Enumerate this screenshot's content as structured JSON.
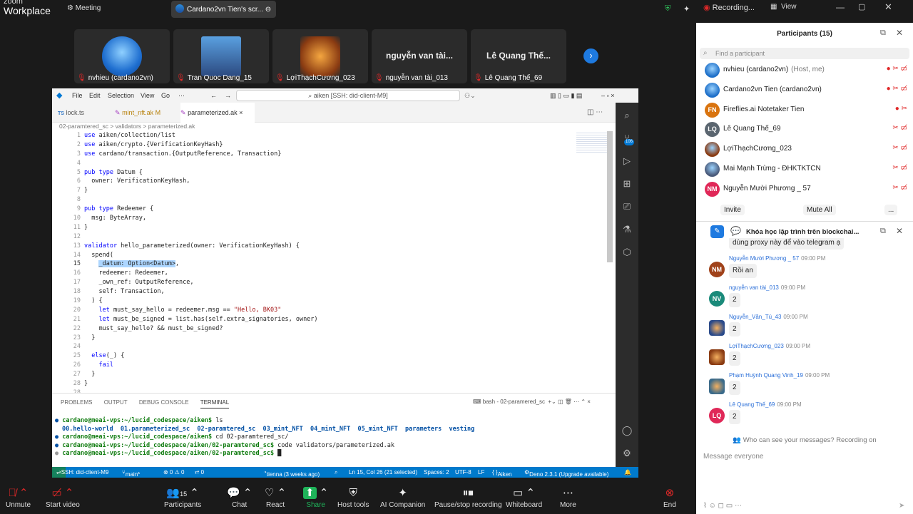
{
  "app": {
    "brand_top": "zoom",
    "brand": "Workplace",
    "meeting_label": "Meeting",
    "share_tab": "Cardano2vn Tien's scr...",
    "recording": "Recording...",
    "view": "View"
  },
  "thumbs": [
    {
      "name": "nvhieu (cardano2vn)"
    },
    {
      "name": "Tran Quoc Dang_15"
    },
    {
      "name": "LợiThạchCương_023"
    },
    {
      "name": "nguyễn van tài_013",
      "big": "nguyễn van tài..."
    },
    {
      "name": "Lê Quang Thế_69",
      "big": "Lê Quang Thế..."
    }
  ],
  "vscode": {
    "menu": [
      "File",
      "Edit",
      "Selection",
      "View",
      "Go",
      "⋯"
    ],
    "search": "aiken [SSH: did-client-M9]",
    "tabs": [
      {
        "label": "lock.ts"
      },
      {
        "label": "mint_nft.ak M"
      },
      {
        "label": "parameterized.ak"
      }
    ],
    "breadcrumb": "02-paramtered_sc  >  validators  >  parameterized.ak",
    "code": [
      "use aiken/collection/list",
      "use aiken/crypto.{VerificationKeyHash}",
      "use cardano/transaction.{OutputReference, Transaction}",
      "",
      "pub type Datum {",
      "  owner: VerificationKeyHash,",
      "}",
      "",
      "pub type Redeemer {",
      "  msg: ByteArray,",
      "}",
      "",
      "validator hello_parameterized(owner: VerificationKeyHash) {",
      "  spend(",
      "    _datum: Option<Datum>,",
      "    redeemer: Redeemer,",
      "    _own_ref: OutputReference,",
      "    self: Transaction,",
      "  ) {",
      "    let must_say_hello = redeemer.msg == \"Hello, BK03\"",
      "    let must_be_signed = list.has(self.extra_signatories, owner)",
      "    must_say_hello? && must_be_signed?",
      "  }",
      "",
      "  else(_) {",
      "    fail",
      "  }",
      "}"
    ],
    "panel_tabs": [
      "PROBLEMS",
      "OUTPUT",
      "DEBUG CONSOLE",
      "TERMINAL"
    ],
    "terminal_label": "bash - 02-paramered_sc",
    "terminal": [
      {
        "prompt": "cardano@meai-vps:~/lucid_codespace/aiken$",
        "cmd": " ls"
      },
      {
        "out": "00.hello-world  01.parameterized_sc  02-paramtered_sc  03_mint_NFT  04_mint_NFT  05_mint_NFT  parameters  vesting"
      },
      {
        "prompt": "cardano@meai-vps:~/lucid_codespace/aiken$",
        "cmd": " cd 02-paramtered_sc/"
      },
      {
        "prompt": "cardano@meai-vps:~/lucid_codespace/aiken/02-paramtered_sc$",
        "cmd": " code validators/parameterized.ak"
      },
      {
        "prompt": "cardano@meai-vps:~/lucid_codespace/aiken/02-paramtered_sc$",
        "cmd": " █"
      }
    ],
    "status": {
      "ssh": "SSH: did-client-M9",
      "branch": "main*",
      "problems": "⊗ 0 ⚠ 0",
      "ports": "⮂ 0",
      "blame": "tienna (3 weeks ago)",
      "pos": "Ln 15, Col 26 (21 selected)",
      "spaces": "Spaces: 2",
      "enc": "UTF-8",
      "eol": "LF",
      "lang": "Aiken",
      "deno": "Deno 2.3.1 (Upgrade available)"
    },
    "badge": "106"
  },
  "participants": {
    "title": "Participants (15)",
    "search": "Find a participant",
    "list": [
      {
        "name": "nvhieu (cardano2vn)",
        "meta": "(Host, me)",
        "initials": "",
        "color": "#1e6fc8"
      },
      {
        "name": "Cardano2vn Tien (cardano2vn)",
        "meta": "",
        "initials": "",
        "color": "#1e6fc8"
      },
      {
        "name": "Fireflies.ai Notetaker Tien",
        "meta": "",
        "initials": "FN",
        "color": "#d9740f"
      },
      {
        "name": "Lê Quang Thế_69",
        "meta": "",
        "initials": "LQ",
        "color": "#5b6670"
      },
      {
        "name": "LợiThạchCương_023",
        "meta": "",
        "initials": "",
        "color": "#8a3b12"
      },
      {
        "name": "Mai Mạnh Trừng - ĐHKTKTCN",
        "meta": "",
        "initials": "",
        "color": "#4a5a7a"
      },
      {
        "name": "Nguyễn Mười Phương _ 57",
        "meta": "",
        "initials": "NM",
        "color": "#e02858"
      }
    ],
    "invite": "Invite",
    "mute_all": "Mute All",
    "more": "..."
  },
  "chat": {
    "title": "Khóa học lập trình trên blockchai...",
    "first_bubble": "dùng proxy này để vào telegram ạ",
    "messages": [
      {
        "name": "Nguyễn Mười Phương _ 57",
        "time": "09:00 PM",
        "text": "Rồi an",
        "initials": "NM",
        "color": "#a0421a"
      },
      {
        "name": "nguyễn van tài_013",
        "time": "09:00 PM",
        "text": "2",
        "initials": "NV",
        "color": "#1a8a7a"
      },
      {
        "name": "Nguyễn_Văn_Tú_43",
        "time": "09:00 PM",
        "text": "2",
        "initials": "",
        "color": "#2a4a8a"
      },
      {
        "name": "LợiThạchCương_023",
        "time": "09:00 PM",
        "text": "2",
        "initials": "",
        "color": "#8a3b12"
      },
      {
        "name": "Phạm Huỳnh Quang Vinh_19",
        "time": "09:00 PM",
        "text": "2",
        "initials": "",
        "color": "#3a6a8a"
      },
      {
        "name": "Lê Quang Thế_69",
        "time": "09:00 PM",
        "text": "2",
        "initials": "LQ",
        "color": "#e02858"
      }
    ],
    "who": "Who can see your messages? Recording on",
    "placeholder": "Message everyone"
  },
  "toolbar": {
    "unmute": "Unmute",
    "video": "Start video",
    "participants": "Participants",
    "participants_count": "15",
    "chat": "Chat",
    "react": "React",
    "share": "Share",
    "host": "Host tools",
    "ai": "AI Companion",
    "record": "Pause/stop recording",
    "whiteboard": "Whiteboard",
    "more": "More",
    "end": "End"
  }
}
